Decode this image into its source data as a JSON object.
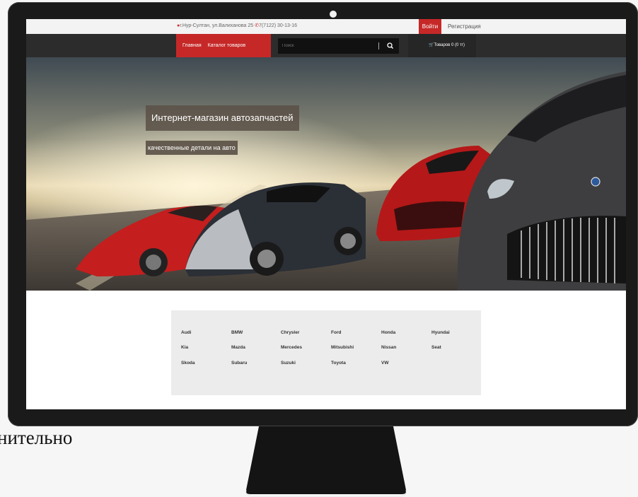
{
  "background_text": "нительно",
  "topbar": {
    "contact_text": "г.Нур-Султан, ул.Валиханова 25",
    "phone": "7(7122) 30-13-16",
    "login_label": "Войти",
    "register_label": "Регистрация"
  },
  "navbar": {
    "home_label": "Главная",
    "catalog_label": "Каталог товаров",
    "search_placeholder": "Поиск",
    "cart_label": "Товаров 0 (0 тг)"
  },
  "hero": {
    "title": "Интернет-магазин автозапчастей",
    "subtitle": "качественные детали на авто"
  },
  "brands": [
    [
      "Audi",
      "BMW",
      "Chrysler",
      "Ford",
      "Honda",
      "Hyundai"
    ],
    [
      "Kia",
      "Mazda",
      "Mercedes",
      "Mitsubishi",
      "Nissan",
      "Seat"
    ],
    [
      "Skoda",
      "Subaru",
      "Suzuki",
      "Toyota",
      "VW"
    ]
  ],
  "colors": {
    "accent_red": "#c62828",
    "nav_dark": "#2c2c2c",
    "brand_panel": "#ececec"
  }
}
